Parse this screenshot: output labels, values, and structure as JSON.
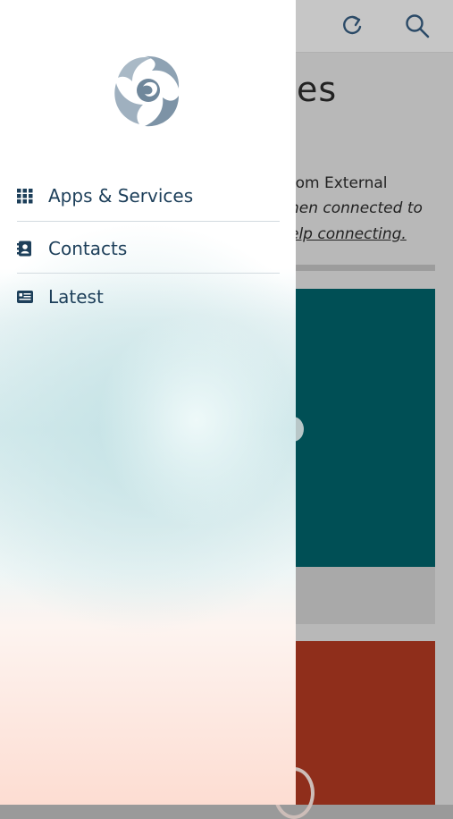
{
  "drawer": {
    "logo_icon": "swirl-logo-icon",
    "items": [
      {
        "label": "Apps & Services",
        "icon": "grid-icon"
      },
      {
        "label": "Contacts",
        "icon": "contact-card-icon"
      },
      {
        "label": "Latest",
        "icon": "news-icon"
      }
    ]
  },
  "background": {
    "title_fragment": "es",
    "line1": "rom External",
    "line2": "hen connected to",
    "line3": "elp connecting.",
    "icons": [
      "refresh-icon",
      "search-icon"
    ],
    "colors": {
      "teal_card": "#004f55",
      "red_card": "#8f2e1b"
    }
  },
  "colors": {
    "drawer_text": "#1d3f5a",
    "logo": "#8ea2b3"
  }
}
